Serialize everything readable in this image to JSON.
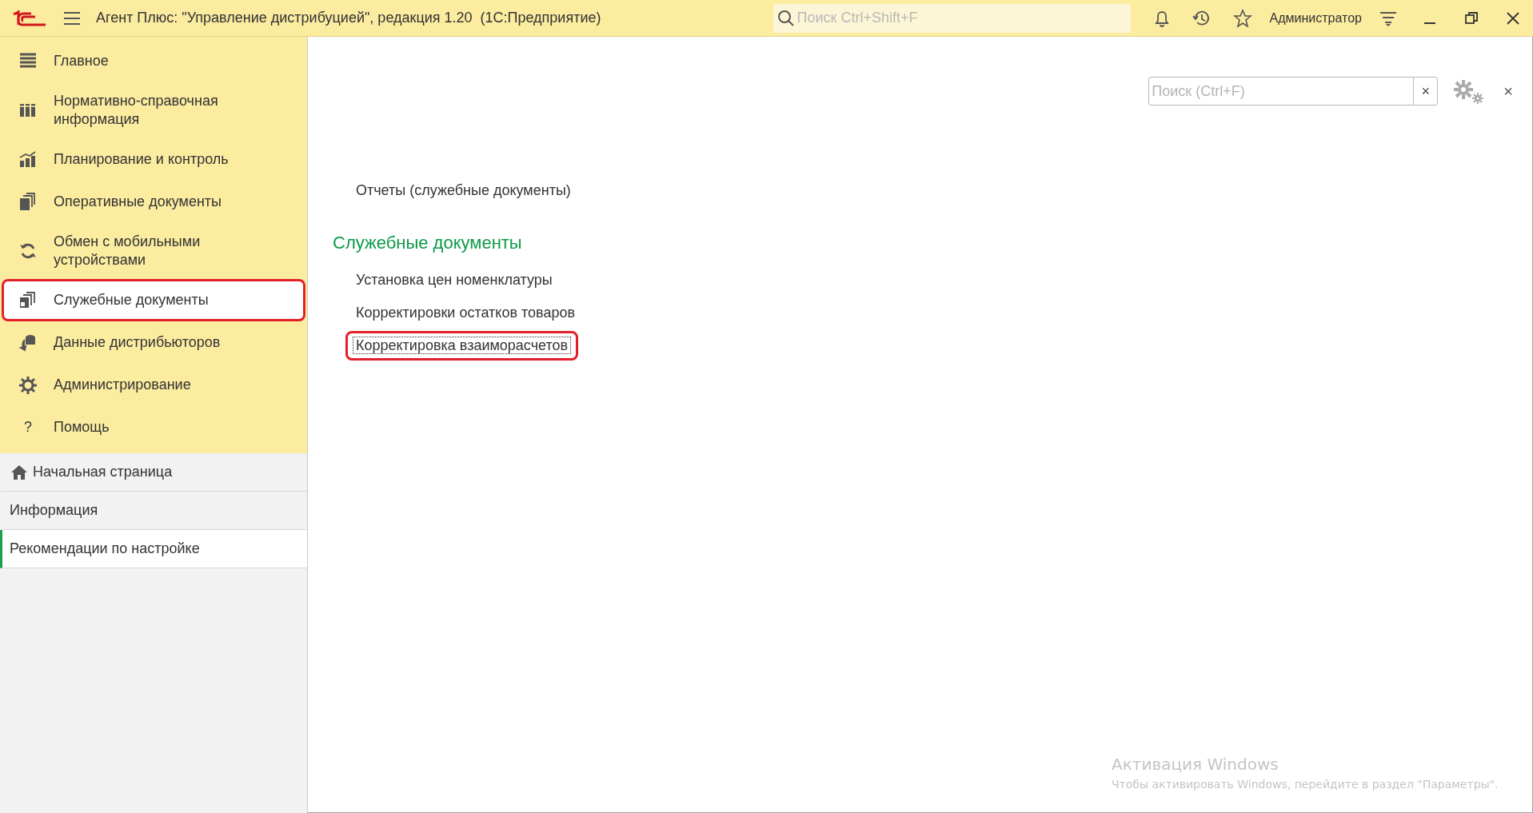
{
  "window": {
    "title": "Агент Плюс: \"Управление дистрибуцией\", редакция 1.20  (1С:Предприятие)",
    "search_placeholder": "Поиск Ctrl+Shift+F",
    "user": "Администратор"
  },
  "sidebar": {
    "sections": [
      {
        "label": "Главное",
        "selected": false,
        "annotated": false
      },
      {
        "label": "Нормативно-справочная информация",
        "selected": false,
        "annotated": false
      },
      {
        "label": "Планирование и контроль",
        "selected": false,
        "annotated": false
      },
      {
        "label": "Оперативные документы",
        "selected": false,
        "annotated": false
      },
      {
        "label": "Обмен с мобильными устройствами",
        "selected": false,
        "annotated": false
      },
      {
        "label": "Служебные документы",
        "selected": true,
        "annotated": true
      },
      {
        "label": "Данные дистрибьюторов",
        "selected": false,
        "annotated": false
      },
      {
        "label": "Администрирование",
        "selected": false,
        "annotated": false
      },
      {
        "label": "Помощь",
        "glyph": "?",
        "selected": false,
        "annotated": false
      }
    ],
    "pages": [
      {
        "label": "Начальная страница",
        "home": true,
        "selected": false
      },
      {
        "label": "Информация",
        "home": false,
        "selected": false
      },
      {
        "label": "Рекомендации по настройке",
        "home": false,
        "selected": true
      }
    ]
  },
  "content": {
    "search_placeholder": "Поиск (Ctrl+F)",
    "clear": "×",
    "close": "×",
    "groups": [
      {
        "links": [
          {
            "label": "Отчеты (служебные документы)",
            "focused": false,
            "annotated": false
          }
        ]
      },
      {
        "heading": "Служебные документы",
        "links": [
          {
            "label": "Установка цен номенклатуры",
            "focused": false,
            "annotated": false
          },
          {
            "label": "Корректировки остатков товаров",
            "focused": false,
            "annotated": false
          },
          {
            "label": "Корректировка взаиморасчетов",
            "focused": true,
            "annotated": true
          }
        ]
      }
    ]
  },
  "activation": {
    "title": "Активация Windows",
    "text": "Чтобы активировать Windows, перейдите в раздел \"Параметры\"."
  }
}
